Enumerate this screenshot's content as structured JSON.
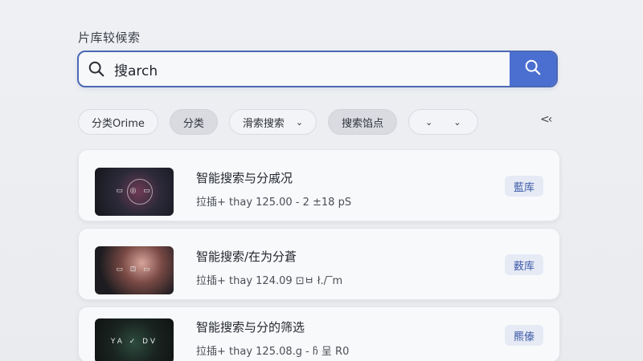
{
  "page": {
    "title": "片库较候索"
  },
  "search": {
    "value": "搜arch",
    "placeholder": "",
    "accent": "#4a6fd0"
  },
  "filters": [
    {
      "label": "分类Orime",
      "active": false
    },
    {
      "label": "分类",
      "active": true
    },
    {
      "label": "滑索搜索",
      "active": false,
      "dropdown": true
    },
    {
      "label": "搜索馅点",
      "active": true
    },
    {
      "label": "",
      "dropdown": true,
      "empty": true
    }
  ],
  "collapse_label": "<‹",
  "results": [
    {
      "title": "智能搜索与分戚况",
      "meta": "拉插+ thay 125.00 - 2 ±18 pS",
      "badge": "藍库",
      "thumb_text": "▭ ◎ ▭"
    },
    {
      "title": "智能搜索/在为分蒼",
      "meta": "拉插+ thay 124.09 ⊡ㅂ ł./‾m",
      "badge": "薮库",
      "thumb_text": "▭ ⊡ ▭"
    },
    {
      "title": "智能搜索与分的筛选",
      "meta": "拉插+ thay 125.08.g - ჩ 呈 R0",
      "badge": "羆傣",
      "thumb_text": "YA ✓ DV"
    }
  ]
}
